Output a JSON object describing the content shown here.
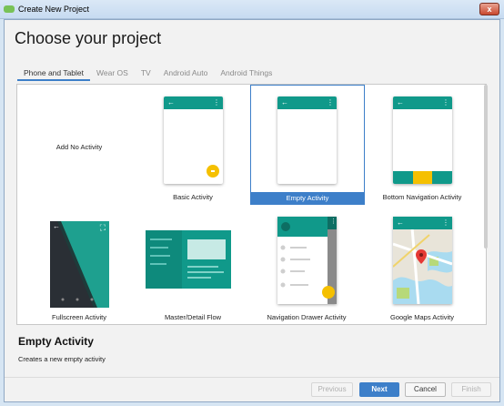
{
  "window": {
    "title": "Create New Project",
    "close_label": "x"
  },
  "page": {
    "title": "Choose your project"
  },
  "tabs": [
    {
      "label": "Phone and Tablet",
      "active": true
    },
    {
      "label": "Wear OS",
      "active": false
    },
    {
      "label": "TV",
      "active": false
    },
    {
      "label": "Android Auto",
      "active": false
    },
    {
      "label": "Android Things",
      "active": false
    }
  ],
  "templates": [
    {
      "label": "Add No Activity",
      "selected": false
    },
    {
      "label": "Basic Activity",
      "selected": false
    },
    {
      "label": "Empty Activity",
      "selected": true
    },
    {
      "label": "Bottom Navigation Activity",
      "selected": false
    },
    {
      "label": "Fullscreen Activity",
      "selected": false
    },
    {
      "label": "Master/Detail Flow",
      "selected": false
    },
    {
      "label": "Navigation Drawer Activity",
      "selected": false
    },
    {
      "label": "Google Maps Activity",
      "selected": false
    }
  ],
  "detail": {
    "title": "Empty Activity",
    "description": "Creates a new empty activity"
  },
  "buttons": {
    "previous": "Previous",
    "next": "Next",
    "cancel": "Cancel",
    "finish": "Finish"
  },
  "icons": {
    "back": "←",
    "menu": "⋮",
    "expand": "⛶"
  },
  "colors": {
    "accent": "#3d7fc9",
    "teal": "#10998a",
    "amber": "#f5c000"
  }
}
